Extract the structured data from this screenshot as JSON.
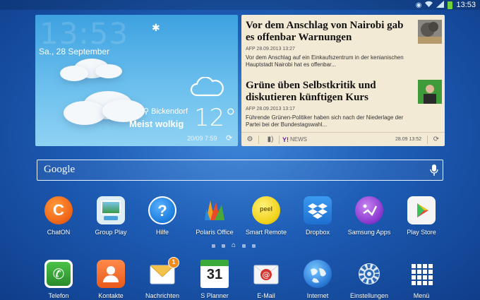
{
  "status_bar": {
    "time": "13:53"
  },
  "weather": {
    "time": "13:53",
    "date": "Sa., 28 September",
    "location": "Bickendorf",
    "condition": "Meist wolkig",
    "temperature": "12°C",
    "updated": "20/09 7:59"
  },
  "news": {
    "items": [
      {
        "headline": "Vor dem Anschlag von Nairobi gab es offenbar Warnungen",
        "meta": "AFP 28.09.2013 13:27",
        "snippet": "Vor dem Anschlag auf ein Einkaufszentrum in der kenianischen Hauptstadt Nairobi hat es offenbar..."
      },
      {
        "headline": "Grüne üben Selbstkritik und diskutieren künftigen Kurs",
        "meta": "AFP 28.09.2013 13:17",
        "snippet": "Führende Grünen-Politiker haben sich nach der Niederlage der Partei bei der Bundestagswahl..."
      }
    ],
    "source": "NEWS",
    "footer_time": "28.09 13:52"
  },
  "search": {
    "label": "Google"
  },
  "apps": [
    {
      "label": "ChatON",
      "icon": "chaton-icon"
    },
    {
      "label": "Group Play",
      "icon": "group-play-icon"
    },
    {
      "label": "Hilfe",
      "icon": "help-icon"
    },
    {
      "label": "Polaris Office",
      "icon": "polaris-office-icon"
    },
    {
      "label": "Smart Remote",
      "icon": "smart-remote-icon"
    },
    {
      "label": "Dropbox",
      "icon": "dropbox-icon"
    },
    {
      "label": "Samsung Apps",
      "icon": "samsung-apps-icon"
    },
    {
      "label": "Play Store",
      "icon": "play-store-icon"
    }
  ],
  "dock": [
    {
      "label": "Telefon",
      "icon": "phone-icon"
    },
    {
      "label": "Kontakte",
      "icon": "contacts-icon"
    },
    {
      "label": "Nachrichten",
      "icon": "messages-icon",
      "badge": "1"
    },
    {
      "label": "S Planner",
      "icon": "calendar-icon",
      "day": "31"
    },
    {
      "label": "E-Mail",
      "icon": "email-icon"
    },
    {
      "label": "Internet",
      "icon": "internet-icon"
    },
    {
      "label": "Einstellungen",
      "icon": "settings-icon"
    },
    {
      "label": "Menü",
      "icon": "apps-menu-icon"
    }
  ],
  "colors": {
    "wallpaper": "#1e5db6",
    "news_background": "#f3ead6",
    "chaton": "#f26a1b",
    "help": "#1f7fe0",
    "dropbox": "#1e7fe0",
    "phone": "#2fa33a",
    "contacts": "#f06a2a",
    "email": "#d6332c"
  }
}
